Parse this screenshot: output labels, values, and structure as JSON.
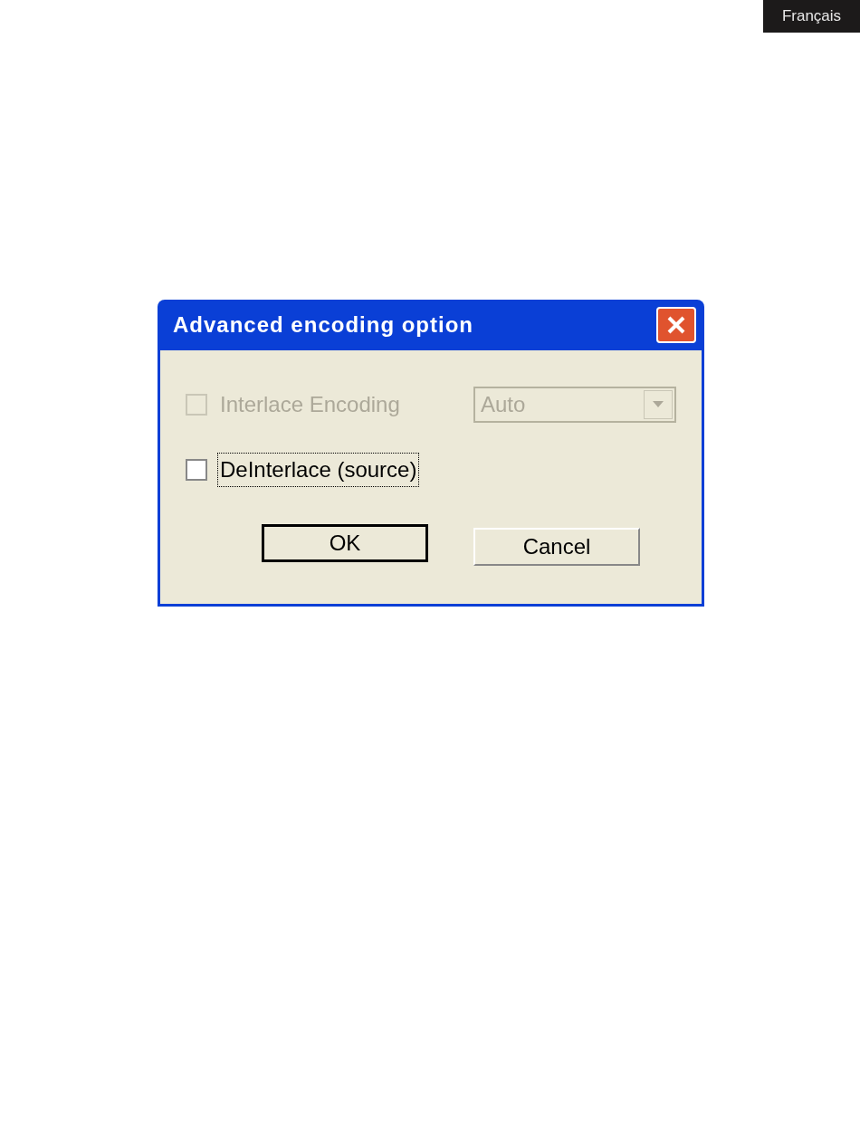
{
  "language_tab": "Français",
  "dialog": {
    "title": "Advanced encoding option",
    "options": [
      {
        "label": "Interlace Encoding",
        "checked": false,
        "disabled": true,
        "focused": false,
        "dropdown": {
          "value": "Auto",
          "disabled": true
        }
      },
      {
        "label": "DeInterlace (source)",
        "checked": false,
        "disabled": false,
        "focused": true
      }
    ],
    "buttons": [
      {
        "label": "OK",
        "default": true
      },
      {
        "label": "Cancel",
        "default": false
      }
    ]
  }
}
